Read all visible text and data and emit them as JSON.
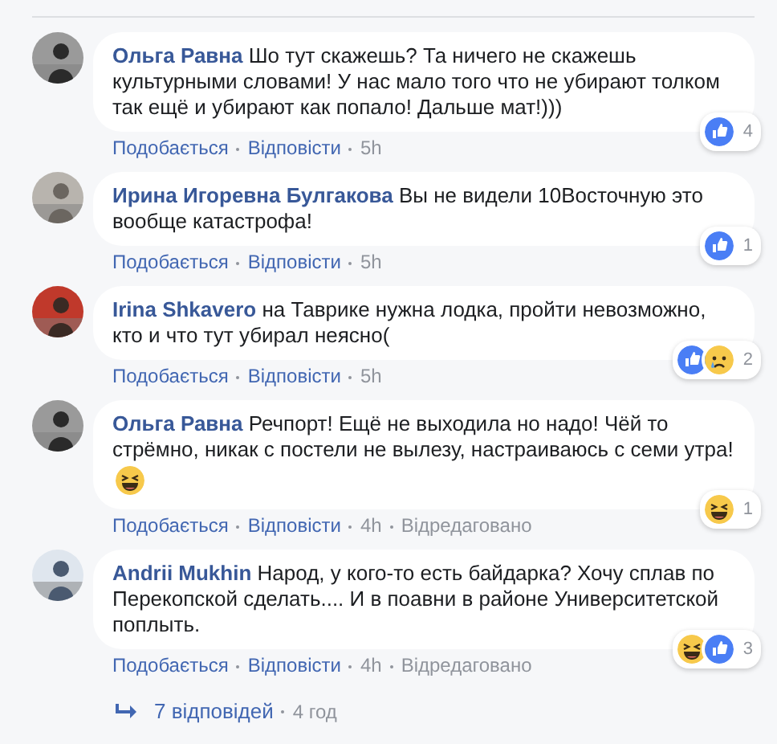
{
  "comments": [
    {
      "author": "Ольга Равна",
      "text": "Шо тут скажешь? Та ничего не скажешь культурными словами! У нас мало того что не убирают толком так ещё и убирают как попало! Дальше мат!)))",
      "reactions": [
        {
          "kind": "like"
        }
      ],
      "reaction_count": "4",
      "like": "Подобається",
      "reply": "Відповісти",
      "time": "5h"
    },
    {
      "author": "Ирина Игоревна Булгакова",
      "text": "Вы не видели 10Восточную это вообще катастрофа!",
      "reactions": [
        {
          "kind": "like"
        }
      ],
      "reaction_count": "1",
      "like": "Подобається",
      "reply": "Відповісти",
      "time": "5h"
    },
    {
      "author": "Irina Shkavero",
      "text": "на Таврике нужна лодка, пройти невозможно, кто и что тут убирал неясно(",
      "reactions": [
        {
          "kind": "like"
        },
        {
          "kind": "sad"
        }
      ],
      "reaction_count": "2",
      "like": "Подобається",
      "reply": "Відповісти",
      "time": "5h"
    },
    {
      "author": "Ольга Равна",
      "text": "Речпорт! Ещё не выходила но надо! Чёй то стрёмно, никак с постели не вылезу, настраиваюсь с семи утра!",
      "emojis": [
        {
          "kind": "haha"
        }
      ],
      "reactions": [
        {
          "kind": "haha"
        }
      ],
      "reaction_count": "1",
      "like": "Подобається",
      "reply": "Відповісти",
      "time": "4h",
      "edited": "Відредаговано"
    },
    {
      "author": "Andrii Mukhin",
      "text": "Народ, у кого-то есть байдарка? Хочу сплав по Перекопской сделать.... И в поавни в районе Университетской поплыть.",
      "reactions": [
        {
          "kind": "haha"
        },
        {
          "kind": "like"
        }
      ],
      "reaction_count": "3",
      "like": "Подобається",
      "reply": "Відповісти",
      "time": "4h",
      "edited": "Відредаговано"
    }
  ],
  "replies": {
    "count": "7 відповідей",
    "time": "4 год"
  }
}
